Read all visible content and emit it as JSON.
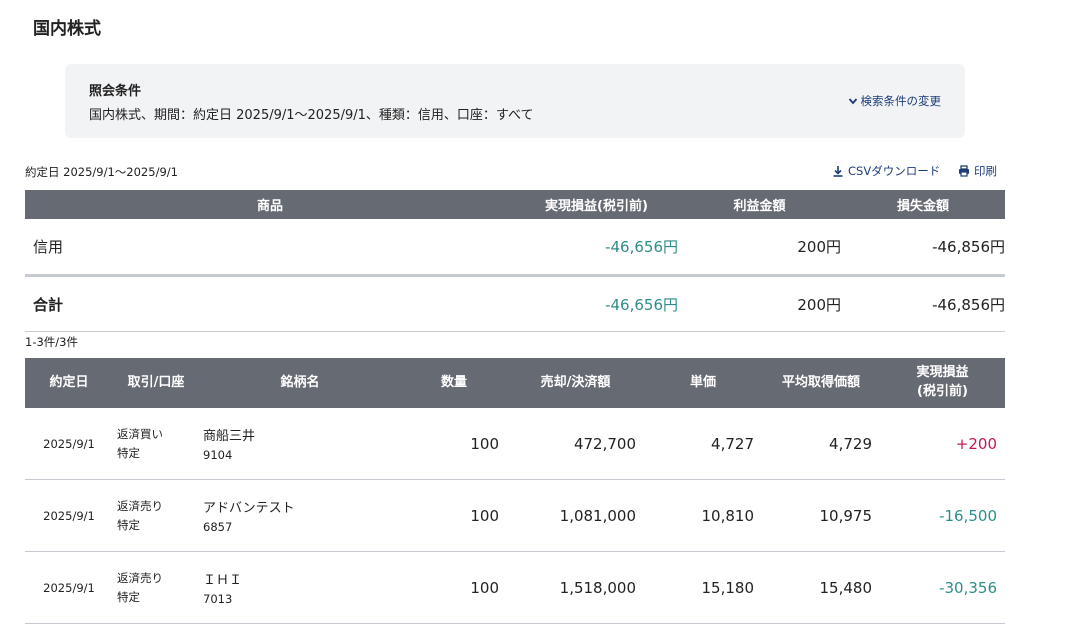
{
  "page": {
    "title": "国内株式"
  },
  "condition": {
    "heading": "照会条件",
    "text": "国内株式、期間：約定日 2025/9/1〜2025/9/1、種類：信用、口座：すべて",
    "change_label": "検索条件の変更"
  },
  "toolbar": {
    "date_range": "約定日 2025/9/1〜2025/9/1",
    "csv_label": "CSVダウンロード",
    "print_label": "印刷"
  },
  "summary": {
    "headers": [
      "商品",
      "実現損益(税引前)",
      "利益金額",
      "損失金額"
    ],
    "rows": [
      {
        "label": "信用",
        "pnl": "-46,656円",
        "profit": "200円",
        "loss": "-46,856円"
      }
    ],
    "total": {
      "label": "合計",
      "pnl": "-46,656円",
      "profit": "200円",
      "loss": "-46,856円"
    }
  },
  "count_text": "1-3件/3件",
  "details": {
    "headers": [
      "約定日",
      "取引/口座",
      "銘柄名",
      "数量",
      "売却/決済額",
      "単価",
      "平均取得価額",
      "実現損益",
      "(税引前)"
    ],
    "rows": [
      {
        "date": "2025/9/1",
        "trade": "返済買い",
        "account": "特定",
        "name": "商船三井",
        "code": "9104",
        "qty": "100",
        "amount": "472,700",
        "price": "4,727",
        "avg": "4,729",
        "pnl": "+200",
        "pnl_color": "#c2185b"
      },
      {
        "date": "2025/9/1",
        "trade": "返済売り",
        "account": "特定",
        "name": "アドバンテスト",
        "code": "6857",
        "qty": "100",
        "amount": "1,081,000",
        "price": "10,810",
        "avg": "10,975",
        "pnl": "-16,500",
        "pnl_color": "#2e8d8a"
      },
      {
        "date": "2025/9/1",
        "trade": "返済売り",
        "account": "特定",
        "name": "ＩＨＩ",
        "code": "7013",
        "qty": "100",
        "amount": "1,518,000",
        "price": "15,180",
        "avg": "15,480",
        "pnl": "-30,356",
        "pnl_color": "#2e8d8a"
      }
    ]
  },
  "icons": {
    "chevron": "chevron-down-icon",
    "download": "download-icon",
    "print": "print-icon"
  },
  "colors": {
    "header_bg": "#666b73",
    "link": "#1d3d7a",
    "loss": "#2e8d8a",
    "gain": "#c2185b"
  }
}
